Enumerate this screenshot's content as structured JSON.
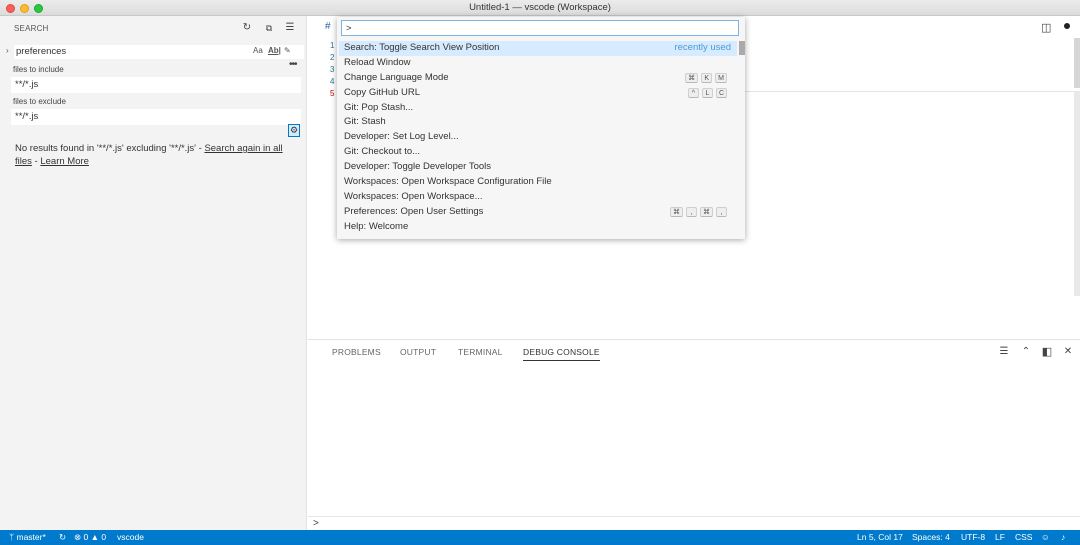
{
  "window": {
    "title": "Untitled-1 — vscode (Workspace)"
  },
  "sidebar": {
    "header": "SEARCH",
    "search_value": "preferences",
    "options": {
      "case": "Aa",
      "word": "Ab|",
      "regex": ".*"
    },
    "files_to_include_label": "files to include",
    "files_to_include_value": "**/*.js",
    "files_to_exclude_label": "files to exclude",
    "files_to_exclude_value": "**/*.js",
    "no_results_prefix": "No results found in '**/*.js' excluding '**/*.js' - ",
    "search_again_link": "Search again in all files",
    "separator": " - ",
    "learn_more_link": "Learn More"
  },
  "editor": {
    "tab_symbol": "#",
    "line_numbers": [
      "1",
      "2",
      "3",
      "4",
      "5"
    ]
  },
  "palette": {
    "input_value": ">",
    "items": [
      {
        "label": "Search: Toggle Search View Position",
        "meta": "recently used"
      },
      {
        "label": "Reload Window"
      },
      {
        "label": "Change Language Mode",
        "keys": [
          "⌘",
          "K",
          "M"
        ]
      },
      {
        "label": "Copy GitHub URL",
        "keys": [
          "^",
          "L",
          "C"
        ]
      },
      {
        "label": "Git: Pop Stash..."
      },
      {
        "label": "Git: Stash"
      },
      {
        "label": "Developer: Set Log Level..."
      },
      {
        "label": "Git: Checkout to..."
      },
      {
        "label": "Developer: Toggle Developer Tools"
      },
      {
        "label": "Workspaces: Open Workspace Configuration File"
      },
      {
        "label": "Workspaces: Open Workspace..."
      },
      {
        "label": "Preferences: Open User Settings",
        "keys": [
          "⌘",
          ",",
          "⌘",
          ","
        ]
      },
      {
        "label": "Help: Welcome"
      }
    ]
  },
  "panel": {
    "tabs": [
      "PROBLEMS",
      "OUTPUT",
      "TERMINAL",
      "DEBUG CONSOLE"
    ],
    "console_prompt": ">"
  },
  "statusbar": {
    "branch": "master*",
    "errors": "0",
    "warnings": "0",
    "project": "vscode",
    "position": "Ln 5, Col 17",
    "spaces": "Spaces: 4",
    "encoding": "UTF-8",
    "eol": "LF",
    "language": "CSS"
  },
  "colors": {
    "accent": "#007acc",
    "selection": "#d6ebff",
    "recently_used": "#4a9ad8"
  }
}
